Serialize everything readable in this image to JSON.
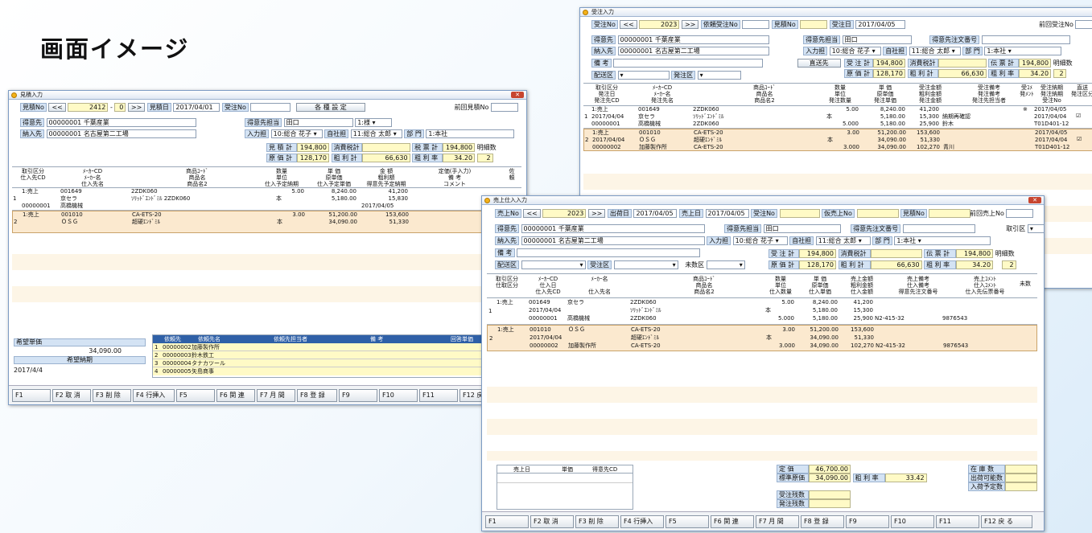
{
  "heading": "画面イメージ",
  "w1": {
    "title": "見積入力",
    "mitsuno_label": "見積No",
    "mitsuno_prev": "<<",
    "mitsuno_value": "2412",
    "mitsuno_dash": "-",
    "mitsuno_sub": "0",
    "mitsuno_next": ">>",
    "mitsudate_label": "見積日",
    "mitsudate_value": "2017/04/01",
    "juchu_label": "受注No",
    "settings_button": "各 種 設 定",
    "prev_label": "前回見積No",
    "tokui_label": "得意先",
    "tokui_code": "00000001",
    "tokui_name": "千葉産業",
    "tanto_label": "得意先担当",
    "tanto_value": "田口",
    "keisho_value": "1:様",
    "nonyu_label": "納入先",
    "nonyu_code": "00000001",
    "nonyu_name": "名古屋第二工場",
    "input_label": "入力担",
    "input_value": "10:総合 花子",
    "jisha_label": "自社担",
    "jisha_value": "11:総合 太郎",
    "bumon_label": "部 門",
    "bumon_value": "1:本社",
    "totals": [
      {
        "label": "見 積 計",
        "value": "194,800"
      },
      {
        "label": "消費税計",
        "value": ""
      },
      {
        "label": "税 票 計",
        "value": "194,800"
      },
      {
        "label": "原 価 計",
        "value": "128,170"
      },
      {
        "label": "粗 利 計",
        "value": "66,630"
      },
      {
        "label": "粗 利 率",
        "value": "34.20"
      }
    ],
    "meisai_label": "明細数",
    "meisai_value": "2",
    "headers": [
      "取引区分\n仕入先CD",
      "ﾒｰｶｰCD\nﾒｰｶｰ名\n仕入先名",
      "商品ｺｰﾄﾞ\n商品名\n商品名2",
      "数量\n単位\n仕入予定納期",
      "単 価\n原単価\n仕入予定単価",
      "金 額\n粗利額\n得意先予定納期",
      "定価(手入力)\n備 考\nコメント",
      "佐\n頼"
    ],
    "rows": [
      {
        "no": "1",
        "kubun": "1:売上",
        "kubun2": "",
        "code": "00000001",
        "maker_cd": "001649",
        "maker": "京セラ",
        "shiire": "高橋機械",
        "shohin": "2ZDK060",
        "shohin2": "ｿﾘｯﾄﾞｴﾝﾄﾞﾐﾙ 2ZDK060",
        "shohin3": "",
        "qty": "5.00",
        "unit": "本",
        "date1": "",
        "price": "8,240.00",
        "price2": "5,180.00",
        "price3": "",
        "amt": "41,200",
        "amt2": "15,830",
        "date2": "2017/04/05"
      },
      {
        "no": "2",
        "kubun": "1:売上",
        "kubun2": "",
        "code": "",
        "maker_cd": "001010",
        "maker": "ＯＳＧ",
        "shiire": "",
        "shohin": "CA-ETS-20",
        "shohin2": "超硬ｴﾝﾄﾞﾐﾙ",
        "shohin3": "",
        "qty": "3.00",
        "unit": "本",
        "date1": "",
        "price": "51,200.00",
        "price2": "34,090.00",
        "price3": "",
        "amt": "153,600",
        "amt2": "51,330",
        "date2": ""
      }
    ],
    "kibou_tanka_label": "希望単価",
    "kibou_tanka_value": "34,090.00",
    "kibou_nouki_label": "希望納期",
    "kibou_nouki_value": "2017/4/4",
    "irai_headers": [
      "依頼先",
      "依頼先名",
      "依頼先担当者",
      "備 考",
      "回答単価"
    ],
    "irai_rows": [
      {
        "no": "1",
        "code": "00000002",
        "name": "加藤製作所"
      },
      {
        "no": "2",
        "code": "00000003",
        "name": "鈴木鉄工"
      },
      {
        "no": "3",
        "code": "00000004",
        "name": "タナカツール"
      },
      {
        "no": "4",
        "code": "00000005",
        "name": "矢島商事"
      }
    ],
    "fkeys": [
      "F1",
      "F2 取 消",
      "F3 削 除",
      "F4 行挿入",
      "F5",
      "F6 関 連",
      "F7 月 間",
      "F8 登 録",
      "F9",
      "F10",
      "F11",
      "F12 戻"
    ]
  },
  "w2": {
    "title": "受注入力",
    "juchu_label": "受注No",
    "juchu_prev": "<<",
    "juchu_value": "2023",
    "juchu_next": ">>",
    "irai_label": "依頼受注No",
    "mitsu_label": "見積No",
    "date_label": "受注日",
    "date_value": "2017/04/05",
    "prev_label": "前回受注No",
    "tokui_label": "得意先",
    "tokui_code": "00000001",
    "tokui_name": "千葉産業",
    "tanto_label": "得意先担当",
    "tanto_value": "田口",
    "chumon_label": "得意先注文番号",
    "nonyu_label": "納入先",
    "nonyu_code": "00000001",
    "nonyu_name": "名古屋第二工場",
    "input_label": "入力担",
    "input_value": "10:総合 花子",
    "jisha_label": "自社担",
    "jisha_value": "11:総合 太郎",
    "bumon_label": "部 門",
    "bumon_value": "1:本社",
    "biko_label": "備 考",
    "chokusou_button": "直送先",
    "haisou_label": "配送区",
    "hacchu_label": "発注区",
    "totals": [
      {
        "label": "受 注 計",
        "value": "194,800"
      },
      {
        "label": "消費税計",
        "value": ""
      },
      {
        "label": "伝 票 計",
        "value": "194,800"
      },
      {
        "label": "原 価 計",
        "value": "128,170"
      },
      {
        "label": "粗 利 計",
        "value": "66,630"
      },
      {
        "label": "粗 利 率",
        "value": "34.20"
      }
    ],
    "meisai_label": "明細数",
    "meisai_value": "2",
    "headers": [
      "取引区分\n発注日\n発注先CD",
      "ﾒｰｶｰCD\nﾒｰｶｰ名\n発注先名",
      "商品ｺｰﾄﾞ\n商品名\n商品名2",
      "数量\n単位\n発注数量",
      "単 価\n原単価\n発注単価",
      "受注金額\n粗利金額\n発注金額",
      "受注備考\n発注備考\n発注先担当者",
      "受ｺﾒ\n発ﾒﾝﾄ",
      "受注納期\n発注納期\n受注No",
      "直送\n発注区分"
    ],
    "rows": [
      {
        "no": "1",
        "kubun": "1:売上",
        "kubun2": "2017/04/04",
        "code": "00000001",
        "maker_cd": "001649",
        "maker": "京セラ",
        "shiire": "高橋機械",
        "shohin": "2ZDK060",
        "shohin2": "ｿﾘｯﾄﾞｴﾝﾄﾞﾐﾙ",
        "shohin3": "2ZDK060",
        "qty": "5.00",
        "unit": "本",
        "date1": "5.000",
        "price": "8,240.00",
        "price2": "5,180.00",
        "price3": "5,180.00",
        "amt": "41,200",
        "amt2": "15,300",
        "date2": "25,900",
        "biko": "",
        "biko2": "納期再確認",
        "biko3": "鈴木",
        "mark": "※",
        "nouki": "2017/04/05",
        "nouki2": "2017/04/04",
        "nouki3": "T01D401-12"
      },
      {
        "no": "2",
        "kubun": "1:売上",
        "kubun2": "2017/04/04",
        "code": "00000002",
        "maker_cd": "001010",
        "maker": "ＯＳＧ",
        "shiire": "加藤製作所",
        "shohin": "CA-ETS-20",
        "shohin2": "超硬ｴﾝﾄﾞﾐﾙ",
        "shohin3": "CA-ETS-20",
        "qty": "3.00",
        "unit": "本",
        "date1": "3.000",
        "price": "51,200.00",
        "price2": "34,090.00",
        "price3": "34,090.00",
        "amt": "153,600",
        "amt2": "51,330",
        "date2": "102,270",
        "biko": "",
        "biko2": "",
        "biko3": "青川",
        "mark": "",
        "nouki": "2017/04/05",
        "nouki2": "2017/04/04",
        "nouki3": "T01D401-12"
      }
    ]
  },
  "w3": {
    "title": "売上仕入入力",
    "uriage_label": "売上No",
    "uriage_prev": "<<",
    "uriage_value": "2023",
    "uriage_next": ">>",
    "shukka_label": "出荷日",
    "shukka_value": "2017/04/05",
    "uriagebi_label": "売上日",
    "uriagebi_value": "2017/04/05",
    "juchu_label": "受注No",
    "kari_label": "仮売上No",
    "mitsu_label": "見積No",
    "prev_label": "前回売上No",
    "tokui_label": "得意先",
    "tokui_code": "00000001",
    "tokui_name": "千葉産業",
    "tanto_label": "得意先担当",
    "tanto_value": "田口",
    "chumon_label": "得意先注文番号",
    "torihiki_label": "取引区",
    "nonyu_label": "納入先",
    "nonyu_code": "00000001",
    "nonyu_name": "名古屋第二工場",
    "input_label": "入力担",
    "input_value": "10:総合 花子",
    "jisha_label": "自社担",
    "jisha_value": "11:総合 太郎",
    "bumon_label": "部 門",
    "bumon_value": "1:本社",
    "biko_label": "備 考",
    "haisou_label": "配送区",
    "juchu_ku_label": "受注区",
    "miharai_label": "未数区",
    "totals": [
      {
        "label": "受 注 計",
        "value": "194,800"
      },
      {
        "label": "消費税計",
        "value": ""
      },
      {
        "label": "伝 票 計",
        "value": "194,800"
      },
      {
        "label": "原 価 計",
        "value": "128,170"
      },
      {
        "label": "粗 利 計",
        "value": "66,630"
      },
      {
        "label": "粗 利 率",
        "value": "34.20"
      }
    ],
    "meisai_label": "明細数",
    "meisai_value": "2",
    "headers": [
      "取引区分\n仕取区分",
      "ﾒｰｶｰCD\n仕入日\n仕入先CD",
      "ﾒｰｶｰ名\n\n仕入先名",
      "商品ｺｰﾄﾞ\n商品名\n商品名2",
      "数量\n単位\n仕入数量",
      "単 価\n原単価\n仕入単価",
      "売上金額\n粗利金額\n仕入金額",
      "売上備考\n仕入備考\n得意先注文番号",
      "売上ｺﾒﾝﾄ\n仕入ｺﾒﾝﾄ\n仕入先伝票番号",
      "未数"
    ],
    "rows": [
      {
        "no": "1",
        "kubun": "1:売上",
        "kubun2": "",
        "code": "",
        "maker_cd": "001649",
        "maker": "京セラ",
        "shiire_date": "2017/04/04",
        "shiire_cd": "00000001",
        "shiire": "高橋機械",
        "shohin": "2ZDK060",
        "shohin2": "ｿﾘｯﾄﾞｴﾝﾄﾞﾐﾙ",
        "shohin3": "2ZDK060",
        "qty": "5.00",
        "unit": "本",
        "date1": "5.000",
        "price": "8,240.00",
        "price2": "5,180.00",
        "price3": "5,180.00",
        "amt": "41,200",
        "amt2": "15,300",
        "date2": "25,900",
        "biko": "",
        "biko2": "",
        "biko3": "N2-415-32",
        "com": "",
        "com2": "",
        "com3": "9876543"
      },
      {
        "no": "2",
        "kubun": "1:売上",
        "kubun2": "",
        "code": "",
        "maker_cd": "001010",
        "maker": "ＯＳＧ",
        "shiire_date": "2017/04/04",
        "shiire_cd": "00000002",
        "shiire": "加藤製作所",
        "shohin": "CA-ETS-20",
        "shohin2": "超硬ｴﾝﾄﾞﾐﾙ",
        "shohin3": "CA-ETS-20",
        "qty": "3.00",
        "unit": "本",
        "date1": "3.000",
        "price": "51,200.00",
        "price2": "34,090.00",
        "price3": "34,090.00",
        "amt": "153,600",
        "amt2": "51,330",
        "date2": "102,270",
        "biko": "",
        "biko2": "",
        "biko3": "N2-415-32",
        "com": "",
        "com2": "",
        "com3": "9876543"
      }
    ],
    "hist_headers": [
      "売上日",
      "単価",
      "得意先CD"
    ],
    "info": {
      "teika_label": "定 価",
      "teika_value": "46,700.00",
      "hyojun_label": "標準原価",
      "hyojun_value": "34,090.00",
      "arari_label": "粗 利 率",
      "arari_value": "33.42",
      "juzan_label": "受注残数",
      "hatzan_label": "発注残数",
      "zaiko_label": "在 庫 数",
      "shukka_label": "出荷可能数",
      "nyuka_label": "入荷予定数"
    },
    "fkeys": [
      "F1",
      "F2 取 消",
      "F3 削 除",
      "F4 行挿入",
      "F5",
      "F6 関 連",
      "F7 月 間",
      "F8 登 録",
      "F9",
      "F10",
      "F11",
      "F12 戻 る"
    ]
  }
}
